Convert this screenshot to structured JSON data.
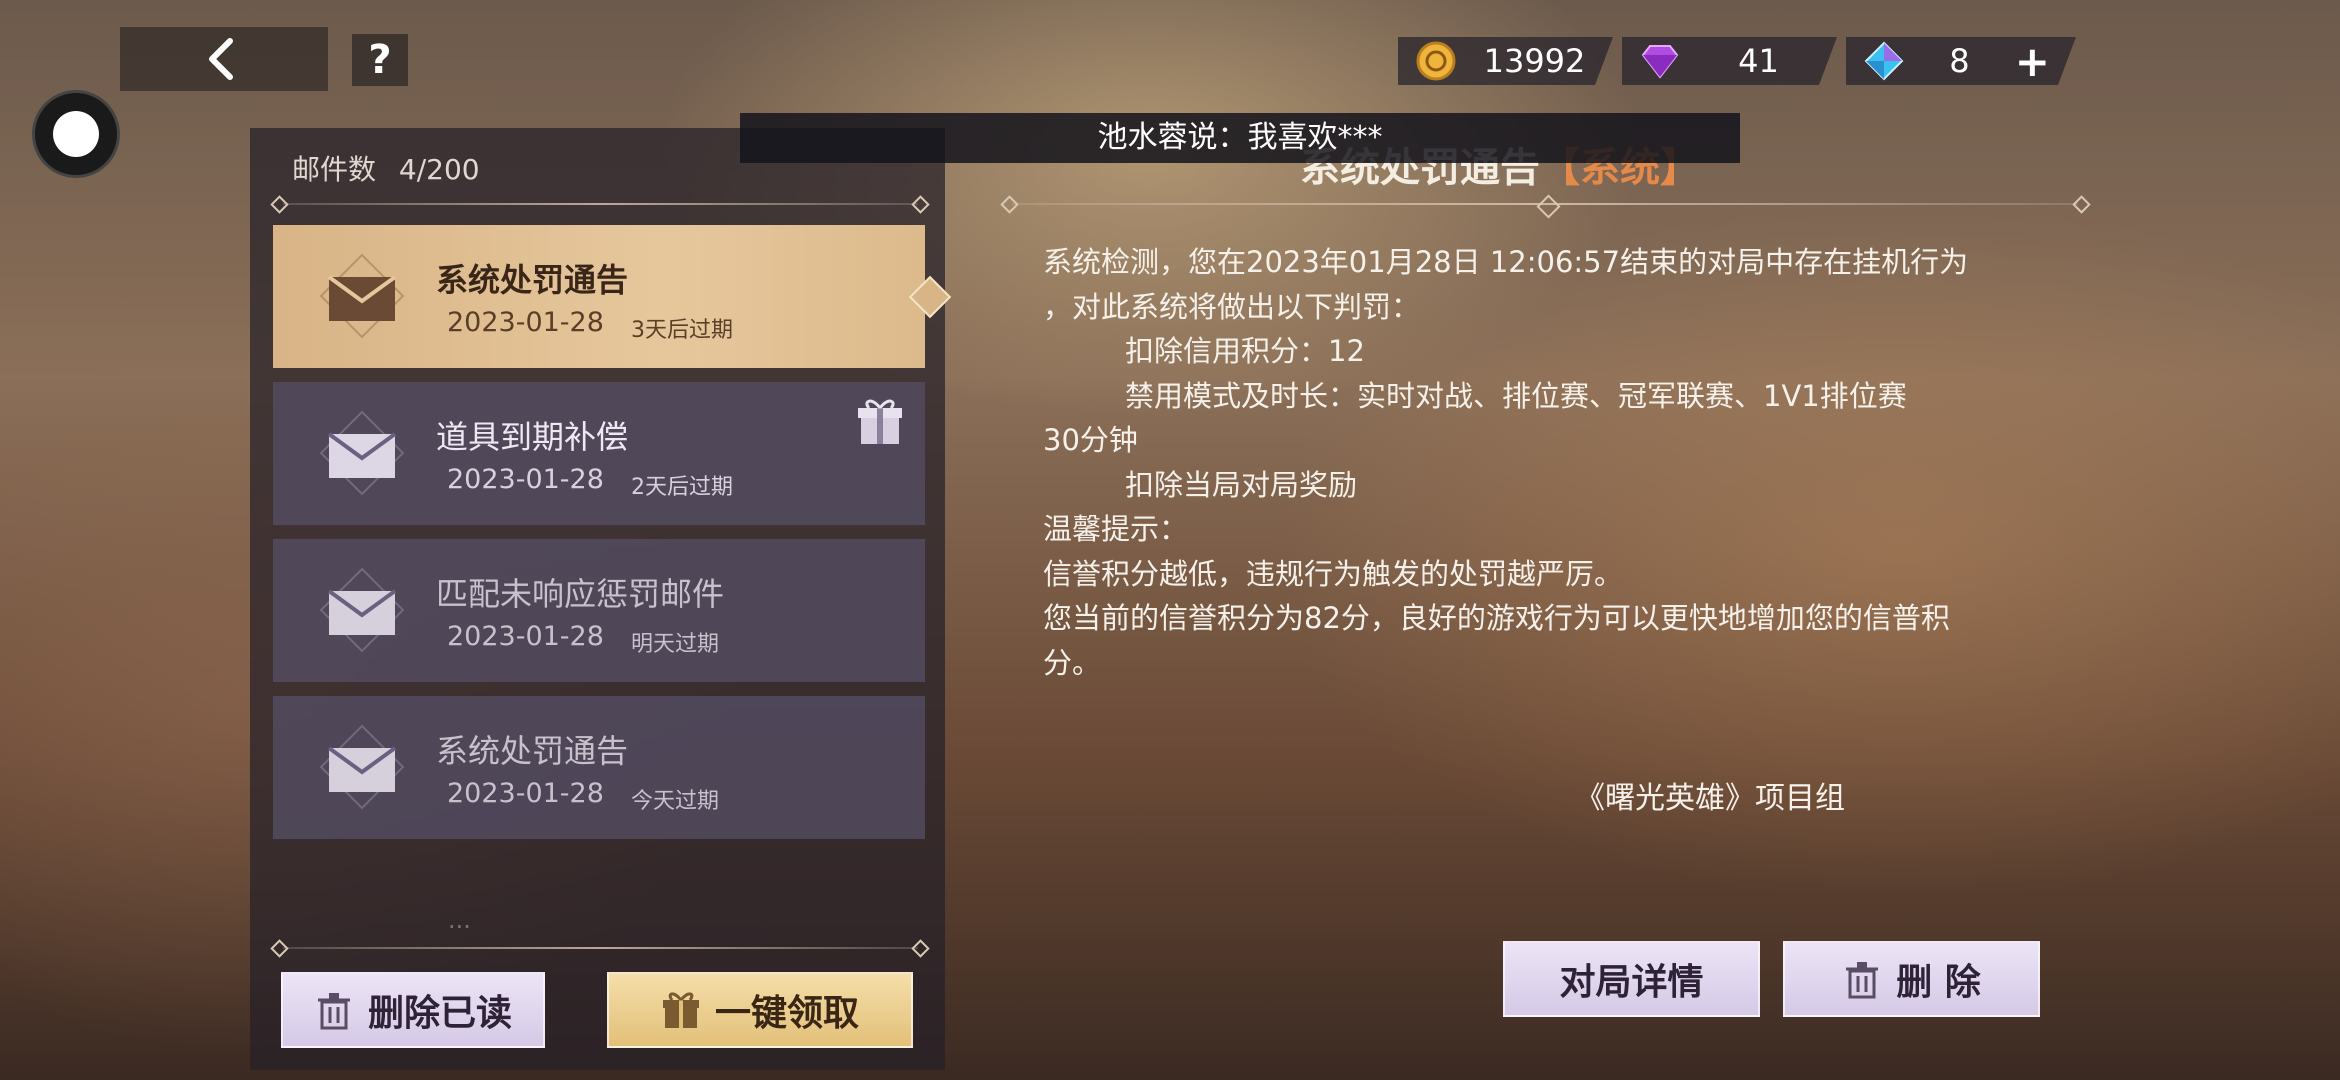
{
  "topbar": {
    "back_icon": "chevron-left-icon",
    "help_label": "?",
    "currencies": [
      {
        "name": "gold-coin",
        "value": "13992",
        "color": "#f0b43c"
      },
      {
        "name": "purple-gem",
        "value": "41",
        "color": "#b04ce0"
      },
      {
        "name": "blue-crystal",
        "value": "8",
        "color": "#3cc0f0"
      }
    ],
    "add_label": "+"
  },
  "notice": {
    "text": "池水蓉说：我喜欢***"
  },
  "mail_list": {
    "count_label": "邮件数",
    "count_value": "4/200",
    "items": [
      {
        "title": "系统处罚通告",
        "date": "2023-01-28",
        "expiry": "3天后过期",
        "selected": true,
        "has_gift": false
      },
      {
        "title": "道具到期补偿",
        "date": "2023-01-28",
        "expiry": "2天后过期",
        "selected": false,
        "has_gift": true
      },
      {
        "title": "匹配未响应惩罚邮件",
        "date": "2023-01-28",
        "expiry": "明天过期",
        "selected": false,
        "has_gift": false
      },
      {
        "title": "系统处罚通告",
        "date": "2023-01-28",
        "expiry": "今天过期",
        "selected": false,
        "has_gift": false
      }
    ],
    "more_label": "...",
    "delete_read_label": "删除已读",
    "claim_all_label": "一键领取"
  },
  "detail": {
    "title": "系统处罚通告",
    "title_tag": "【系统】",
    "lines": [
      "系统检测，您在2023年01月28日 12:06:57结束的对局中存在挂机行为",
      "，对此系统将做出以下判罚：",
      "扣除信用积分：12",
      "禁用模式及时长：实时对战、排位赛、冠军联赛、1V1排位赛",
      "30分钟",
      "扣除当局对局奖励",
      "温馨提示：",
      "信誉积分越低，违规行为触发的处罚越严厉。",
      "您当前的信誉积分为82分，良好的游戏行为可以更快地增加您的信普积",
      "分。"
    ],
    "signature": "《曙光英雄》项目组",
    "match_details_label": "对局详情",
    "delete_label": "删 除"
  }
}
